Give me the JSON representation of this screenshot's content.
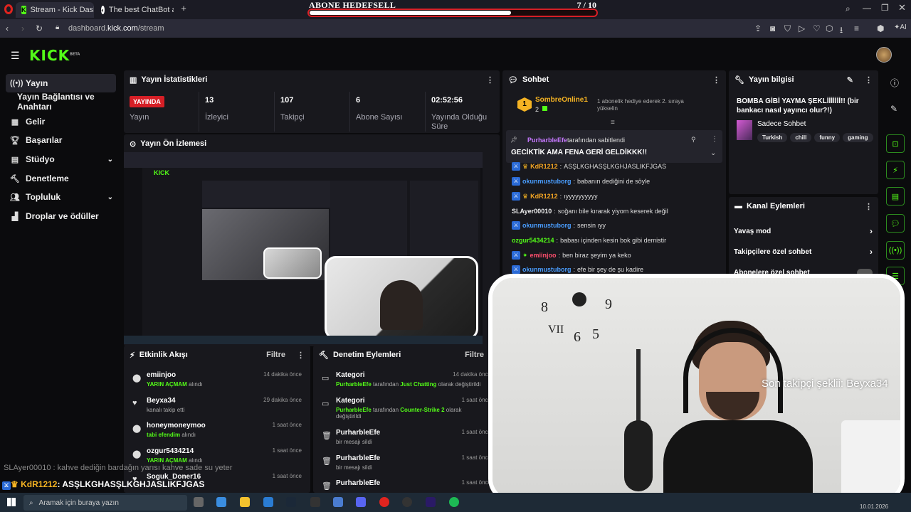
{
  "browser": {
    "tabs": [
      {
        "label": "Stream - Kick Dashboard",
        "active": true
      },
      {
        "label": "The best ChatBot and W",
        "active": false
      }
    ],
    "url_prefix": "dashboard.",
    "url_host": "kick.com",
    "url_path": "/stream"
  },
  "goal": {
    "title": "ABONE HEDEFSELL",
    "count": "7 / 10",
    "progress": 0.7
  },
  "header": {
    "logo": "KICK",
    "logo_sup": "BETA"
  },
  "sidebar": {
    "items": [
      {
        "label": "Yayın",
        "icon": "broadcast-icon",
        "active": true
      },
      {
        "label": "Yayın Bağlantısı ve Anahtarı",
        "icon": "",
        "active": false
      },
      {
        "label": "Gelir",
        "icon": "income-icon",
        "active": false
      },
      {
        "label": "Başarılar",
        "icon": "trophy-icon",
        "active": false
      },
      {
        "label": "Stüdyo",
        "icon": "studio-icon",
        "active": false,
        "chevron": true
      },
      {
        "label": "Denetleme",
        "icon": "moderation-icon",
        "active": false
      },
      {
        "label": "Topluluk",
        "icon": "community-icon",
        "active": false,
        "chevron": true
      },
      {
        "label": "Droplar ve ödüller",
        "icon": "drops-icon",
        "active": false
      }
    ]
  },
  "stats": {
    "title": "Yayın İstatistikleri",
    "status_badge": "YAYINDA",
    "items": [
      {
        "value": "",
        "label": "Yayın"
      },
      {
        "value": "13",
        "label": "İzleyici"
      },
      {
        "value": "107",
        "label": "Takipçi"
      },
      {
        "value": "6",
        "label": "Abone Sayısı"
      },
      {
        "value": "02:52:56",
        "label": "Yayında Olduğu Süre"
      }
    ]
  },
  "preview": {
    "title": "Yayın Ön İzlemesi"
  },
  "activity": {
    "title": "Etkinlik Akışı",
    "filter": "Filtre",
    "items": [
      {
        "name": "emiinjoo",
        "detail_hl": "YARIN AÇMAM",
        "detail": " alındı",
        "time": "14 dakika önce",
        "icon": "reward-icon"
      },
      {
        "name": "Beyxa34",
        "detail_hl": "",
        "detail": "kanalı takip etti",
        "time": "29 dakika önce",
        "icon": "heart-icon"
      },
      {
        "name": "honeymoneymoo",
        "detail_hl": "tabi efendim",
        "detail": " alındı",
        "time": "1 saat önce",
        "icon": "reward-icon"
      },
      {
        "name": "ozgur5434214",
        "detail_hl": "YARIN AÇMAM",
        "detail": " alındı",
        "time": "1 saat önce",
        "icon": "reward-icon"
      },
      {
        "name": "Soguk_Doner16",
        "detail_hl": "",
        "detail": "",
        "time": "1 saat önce",
        "icon": "heart-icon"
      }
    ]
  },
  "moderation": {
    "title": "Denetim Eylemleri",
    "filter": "Filtre",
    "items": [
      {
        "name": "Kategori",
        "actor": "PurharbleEfe",
        "mid": " tarafından ",
        "target": "Just Chatting",
        "end": " olarak değiştirildi",
        "time": "14 dakika önce",
        "icon": "category-icon"
      },
      {
        "name": "Kategori",
        "actor": "PurharbleEfe",
        "mid": " tarafından ",
        "target": "Counter-Strike 2",
        "end": " olarak değiştirildi",
        "time": "1 saat önce",
        "icon": "category-icon"
      },
      {
        "name": "PurharbleEfe",
        "actor": "",
        "mid": "bir mesajı sildi",
        "target": "",
        "end": "",
        "time": "1 saat önce",
        "icon": "trash-icon"
      },
      {
        "name": "PurharbleEfe",
        "actor": "",
        "mid": "bir mesajı sildi",
        "target": "",
        "end": "",
        "time": "1 saat önce",
        "icon": "trash-icon"
      },
      {
        "name": "PurharbleEfe",
        "actor": "",
        "mid": "",
        "target": "",
        "end": "",
        "time": "1 saat önce",
        "icon": "trash-icon"
      }
    ]
  },
  "chat": {
    "title": "Sohbet",
    "top_gifter": {
      "name": "SombreOnline1",
      "rank": "1",
      "count": "2",
      "promo": "1 abonelik hediye ederek 2. sıraya yükselin"
    },
    "pinned": {
      "user": "PurharbleEfe",
      "by": "tarafından sabitlendi",
      "text": "GECİKTİK AMA FENA GERİ GELDİKKK!!"
    },
    "messages": [
      {
        "user": "KdR1212",
        "text": "ASŞLKGHASŞLKGHJASLIKFJGAS",
        "color": "#f5a623",
        "badges": 2
      },
      {
        "user": "okunmustuborg",
        "text": "babanın dediğini de söyle",
        "color": "#4a9eff",
        "badges": 1
      },
      {
        "user": "KdR1212",
        "text": "ıyyyyyyyyyy",
        "color": "#f5a623",
        "badges": 2
      },
      {
        "user": "SLAyer00010",
        "text": "soğanı bile kırarak yiyom keserek değil",
        "color": "#eeeeee",
        "badges": 0
      },
      {
        "user": "okunmustuborg",
        "text": "sensin ıyy",
        "color": "#4a9eff",
        "badges": 1
      },
      {
        "user": "ozgur5434214",
        "text": "babası içinden kesin bok gibi demistir",
        "color": "#53fc18",
        "badges": 0
      },
      {
        "user": "emiinjoo",
        "text": "ben biraz şeyim ya keko",
        "color": "#ff4f6d",
        "badges": 2
      },
      {
        "user": "okunmustuborg",
        "text": "efe bir şey de şu kadire",
        "color": "#4a9eff",
        "badges": 1
      }
    ]
  },
  "info": {
    "title": "Yayın bilgisi",
    "stream_title": "BOMBA GİBİ YAYMA ŞEKLİİİİİİİ!! (bir bankacı nasıl yayıncı olur?!)",
    "category": "Sadece Sohbet",
    "tags": [
      "Turkish",
      "chill",
      "funny",
      "gaming"
    ]
  },
  "channel_actions": {
    "title": "Kanal Eylemleri",
    "items": [
      {
        "label": "Yavaş mod",
        "control": "arrow"
      },
      {
        "label": "Takipçilere özel sohbet",
        "control": "arrow"
      },
      {
        "label": "Abonelere özel sohbet",
        "control": "toggle"
      }
    ]
  },
  "overlay": {
    "follower_text": "Son takipçi şeklii: Beyxa34",
    "chat_line1": "SLAyer00010 : kahve dediğin bardağın yarısı kahve sade su yeter",
    "chat_line2_user": "KdR1212",
    "chat_line2_text": ": ASŞLKGHASŞLKGHJASLIKFJGAS"
  },
  "taskbar": {
    "search_placeholder": "Aramak için buraya yazın",
    "date": "10.01.2026"
  },
  "colors": {
    "accent": "#53fc18",
    "live": "#d61f26",
    "panel": "#18181d"
  }
}
